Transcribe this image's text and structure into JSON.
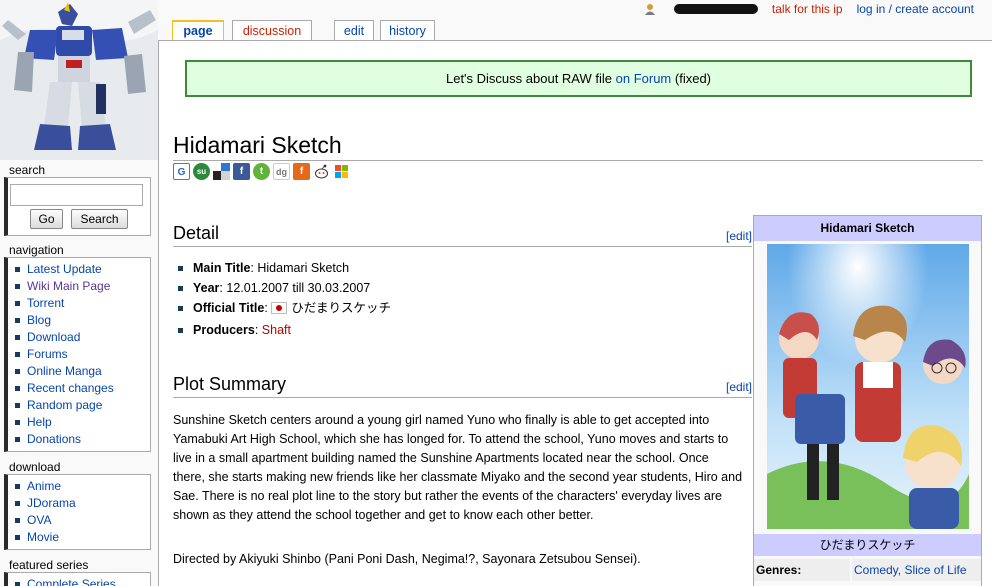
{
  "personal": {
    "talk_label": "talk for this ip",
    "login_label": "log in / create account"
  },
  "tabs": {
    "page": "page",
    "discussion": "discussion",
    "edit": "edit",
    "history": "history"
  },
  "sitenotice": {
    "text": "Let's Discuss about RAW file",
    "link": "on Forum",
    "suffix": "(fixed)"
  },
  "page_title": "Hidamari Sketch",
  "share_icons": [
    "google-icon",
    "stumbleupon-icon",
    "delicious-icon",
    "facebook-icon",
    "technorati-icon",
    "digg-icon",
    "furl-icon",
    "reddit-icon",
    "windows-live-icon"
  ],
  "detail": {
    "heading": "Detail",
    "edit_label": "[edit]",
    "items": [
      {
        "label": "Main Title",
        "value": ": Hidamari Sketch"
      },
      {
        "label": "Year",
        "value": ": 12.01.2007 till 30.03.2007"
      },
      {
        "label": "Official Title",
        "value": "ひだまりスケッチ"
      },
      {
        "label": "Producers",
        "value": "Shaft"
      }
    ]
  },
  "plot": {
    "heading": "Plot Summary",
    "edit_label": "[edit]",
    "text": "Sunshine Sketch centers around a young girl named Yuno who finally is able to get accepted into Yamabuki Art High School, which she has longed for. To attend the school, Yuno moves and starts to live in a small apartment building named the Sunshine Apartments located near the school. Once there, she starts making new friends like her classmate Miyako and the second year students, Hiro and Sae. There is no real plot line to the story but rather the events of the characters' everyday lives are shown as they attend the school together and get to know each other better.",
    "directed": "Directed by Akiyuki Shinbo (Pani Poni Dash, Negima!?, Sayonara Zetsubou Sensei)."
  },
  "infobox": {
    "title": "Hidamari Sketch",
    "caption": "ひだまりスケッチ",
    "genres_label": "Genres:",
    "genres_value": "Comedy, Slice of Life"
  },
  "sidebar": {
    "search": {
      "title": "search",
      "go": "Go",
      "search": "Search"
    },
    "navigation": {
      "title": "navigation",
      "items": [
        "Latest Update",
        "Wiki Main Page",
        "Torrent",
        "Blog",
        "Download",
        "Forums",
        "Online Manga",
        "Recent changes",
        "Random page",
        "Help",
        "Donations"
      ]
    },
    "download": {
      "title": "download",
      "items": [
        "Anime",
        "JDorama",
        "OVA",
        "Movie"
      ]
    },
    "featured": {
      "title": "featured series",
      "items": [
        "Complete Series"
      ]
    }
  },
  "colors": {
    "link": "#0645ad",
    "red_link": "#ba0000",
    "notice_bg": "#e0ffe0",
    "notice_border": "#3c8a3c",
    "infobox_header": "#ccccff",
    "tab_selected": "#fabd23"
  }
}
